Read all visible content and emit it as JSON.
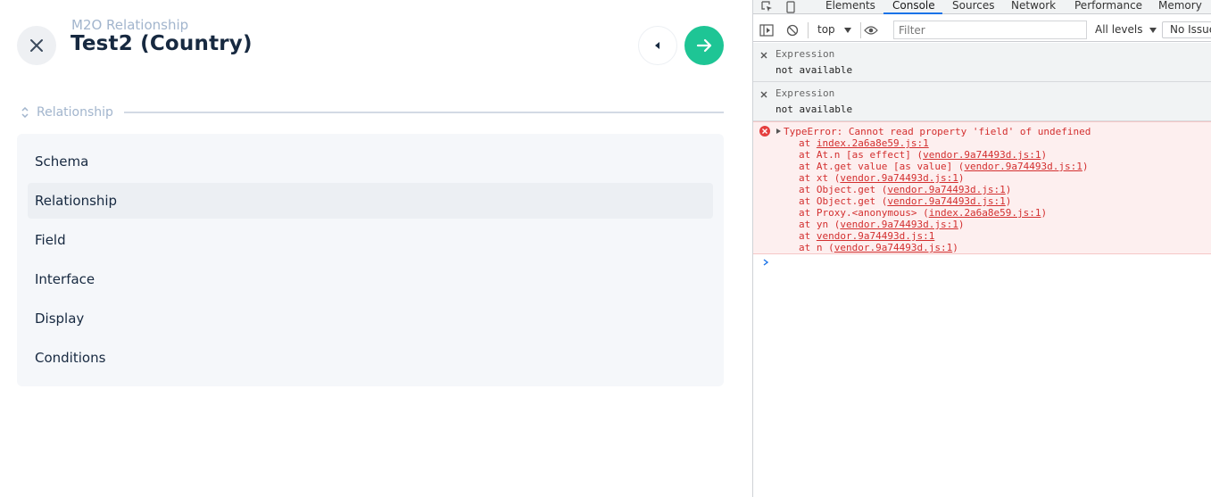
{
  "app": {
    "subtitle": "M2O Relationship",
    "title": "Test2 (Country)",
    "group_label": "Relationship",
    "nav_items": [
      {
        "label": "Schema",
        "active": false
      },
      {
        "label": "Relationship",
        "active": true
      },
      {
        "label": "Field",
        "active": false
      },
      {
        "label": "Interface",
        "active": false
      },
      {
        "label": "Display",
        "active": false
      },
      {
        "label": "Conditions",
        "active": false
      }
    ],
    "colors": {
      "accent": "#1ec595",
      "title": "#172940",
      "muted": "#a2b5cd"
    },
    "icons": {
      "close": "close-icon",
      "prev": "caret-left-icon",
      "next": "arrow-right-icon",
      "group": "collapse-chevron-icon"
    }
  },
  "devtools": {
    "tabs": [
      "Elements",
      "Console",
      "Sources",
      "Network",
      "Performance",
      "Memory"
    ],
    "active_tab": "Console",
    "toolbar": {
      "context": "top",
      "filter_placeholder": "Filter",
      "levels": "All levels",
      "issues": "No Issues"
    },
    "expressions": [
      {
        "name": "Expression",
        "value": "not available"
      },
      {
        "name": "Expression",
        "value": "not available"
      }
    ],
    "error": {
      "message": "TypeError: Cannot read property 'field' of undefined",
      "stack": [
        {
          "prefix": "at ",
          "link": "index.2a6a8e59.js:1",
          "suffix": ""
        },
        {
          "prefix": "at At.n [as effect] (",
          "link": "vendor.9a74493d.js:1",
          "suffix": ")"
        },
        {
          "prefix": "at At.get value [as value] (",
          "link": "vendor.9a74493d.js:1",
          "suffix": ")"
        },
        {
          "prefix": "at xt (",
          "link": "vendor.9a74493d.js:1",
          "suffix": ")"
        },
        {
          "prefix": "at Object.get (",
          "link": "vendor.9a74493d.js:1",
          "suffix": ")"
        },
        {
          "prefix": "at Object.get (",
          "link": "vendor.9a74493d.js:1",
          "suffix": ")"
        },
        {
          "prefix": "at Proxy.<anonymous> (",
          "link": "index.2a6a8e59.js:1",
          "suffix": ")"
        },
        {
          "prefix": "at yn (",
          "link": "vendor.9a74493d.js:1",
          "suffix": ")"
        },
        {
          "prefix": "at ",
          "link": "vendor.9a74493d.js:1",
          "suffix": ""
        },
        {
          "prefix": "at n (",
          "link": "vendor.9a74493d.js:1",
          "suffix": ")"
        }
      ]
    },
    "colors": {
      "error_text": "#d32f2f",
      "error_bg": "#fdefef",
      "tab_accent": "#1a73e8"
    }
  }
}
